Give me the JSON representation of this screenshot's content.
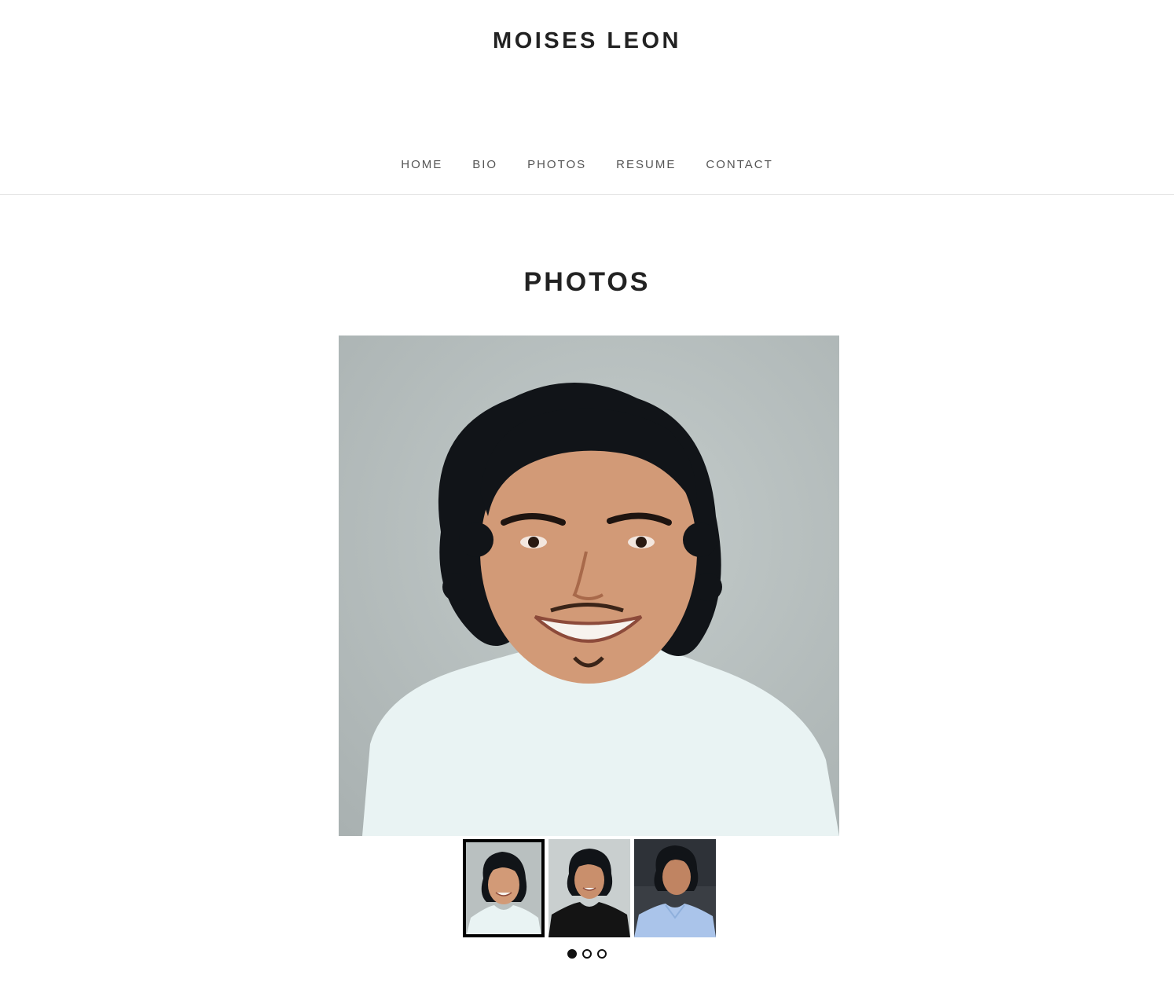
{
  "site": {
    "title": "MOISES LEON"
  },
  "nav": {
    "items": [
      {
        "label": "HOME"
      },
      {
        "label": "BIO"
      },
      {
        "label": "PHOTOS"
      },
      {
        "label": "RESUME"
      },
      {
        "label": "CONTACT"
      }
    ]
  },
  "page": {
    "heading": "PHOTOS"
  },
  "gallery": {
    "active_index": 0,
    "slide_count": 3,
    "colors": {
      "accent": "#111111",
      "backdrop": "#b9c0c0"
    }
  }
}
